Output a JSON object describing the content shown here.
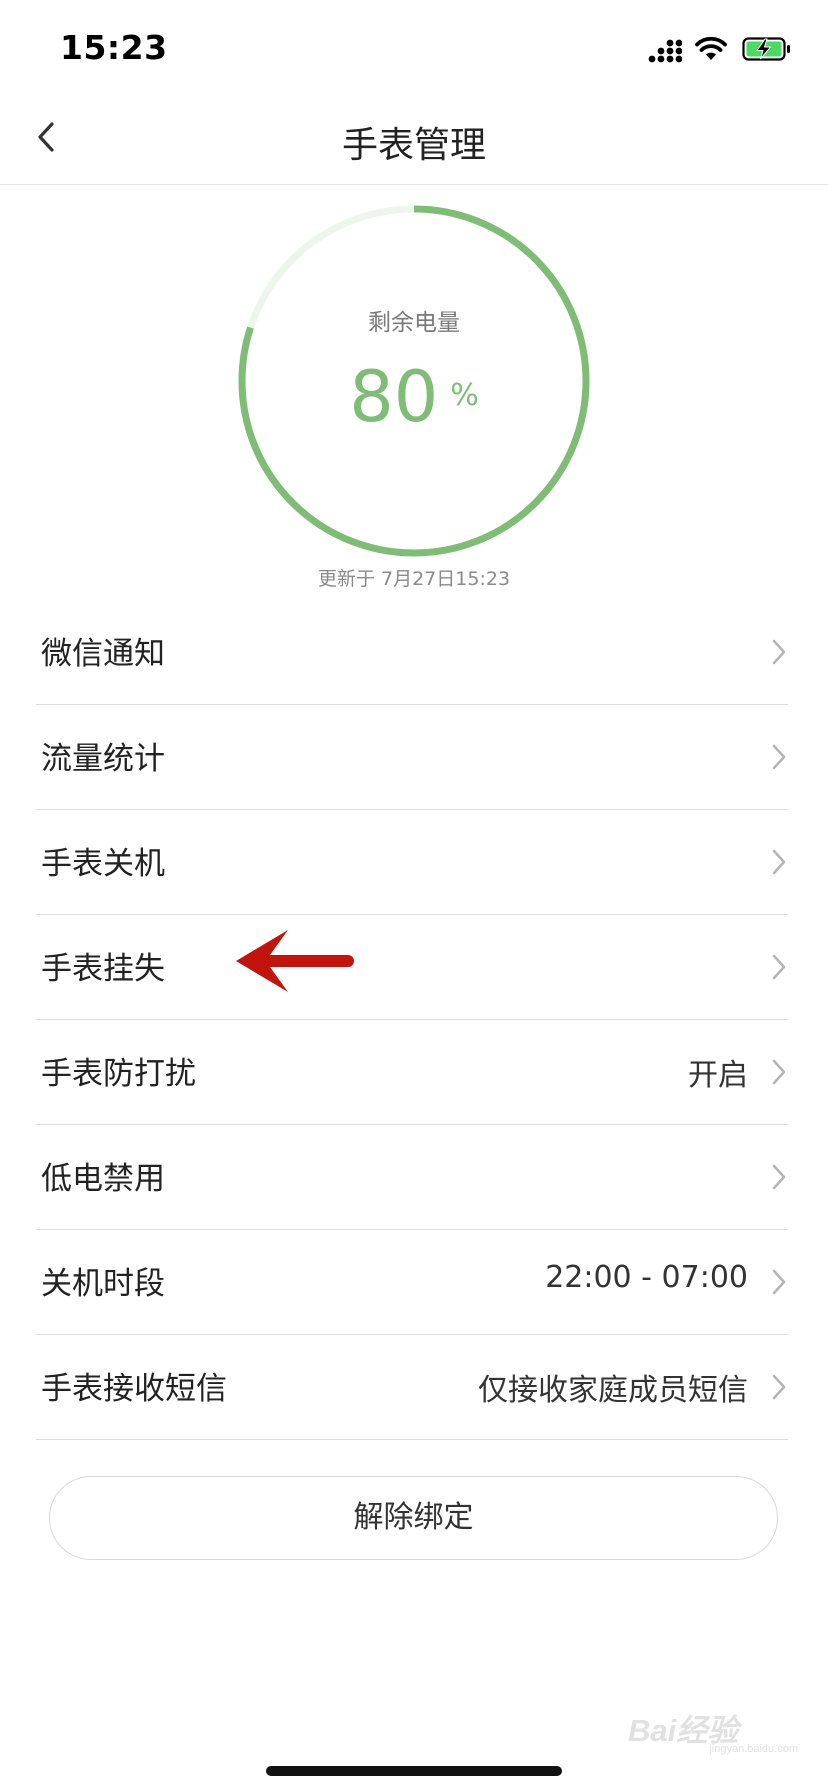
{
  "status_bar": {
    "time": "15:23"
  },
  "nav": {
    "title": "手表管理"
  },
  "battery": {
    "label": "剩余电量",
    "value": "80",
    "unit": "%",
    "level": 0.8,
    "update_text": "更新于 7月27日15:23"
  },
  "menu": {
    "items": [
      {
        "label": "微信通知",
        "value": ""
      },
      {
        "label": "流量统计",
        "value": ""
      },
      {
        "label": "手表关机",
        "value": ""
      },
      {
        "label": "手表挂失",
        "value": ""
      },
      {
        "label": "手表防打扰",
        "value": "开启"
      },
      {
        "label": "低电禁用",
        "value": ""
      },
      {
        "label": "关机时段",
        "value": "22:00 - 07:00"
      },
      {
        "label": "手表接收短信",
        "value": "仅接收家庭成员短信"
      }
    ]
  },
  "unbind_button": {
    "label": "解除绑定"
  },
  "watermark": {
    "text": "Bai经验",
    "sub": "jingyan.baidu.com"
  },
  "colors": {
    "accent_green": "#7fbd76",
    "ring_track": "#eef5ec",
    "annotation_red": "#c0140c",
    "battery_icon_green": "#4cd964"
  },
  "icons": {
    "back": "chevron-left-icon",
    "chevron": "chevron-right-icon",
    "signal": "cellular-signal-icon",
    "wifi": "wifi-icon",
    "battery": "battery-charging-icon",
    "annotation": "red-arrow-left-icon"
  }
}
